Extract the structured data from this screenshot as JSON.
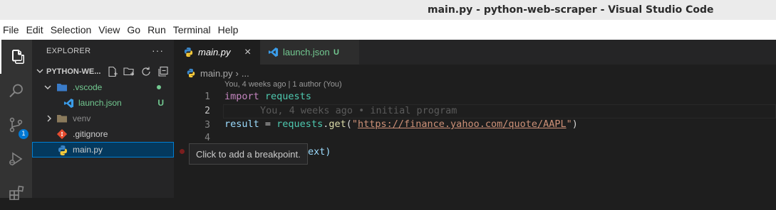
{
  "window": {
    "title": "main.py - python-web-scraper - Visual Studio Code"
  },
  "menu": [
    "File",
    "Edit",
    "Selection",
    "View",
    "Go",
    "Run",
    "Terminal",
    "Help"
  ],
  "activity_bar": {
    "items": [
      "files-icon",
      "search-icon",
      "source-control-icon",
      "run-debug-icon",
      "extensions-icon"
    ],
    "source_control_badge": "1"
  },
  "explorer": {
    "header": "EXPLORER",
    "more": "···",
    "folder": "PYTHON-WE...",
    "tree": [
      {
        "label": ".vscode",
        "type": "folder",
        "expanded": true,
        "color": "#73c991"
      },
      {
        "label": "launch.json",
        "type": "file",
        "status": "U",
        "color": "#73c991"
      },
      {
        "label": "venv",
        "type": "folder",
        "expanded": false,
        "color": "#8c8c8c"
      },
      {
        "label": ".gitignore",
        "type": "file",
        "color": "#cccccc"
      },
      {
        "label": "main.py",
        "type": "file",
        "selected": true,
        "color": "#cccccc"
      }
    ]
  },
  "tabs": [
    {
      "label": "main.py",
      "active": true,
      "close": "×"
    },
    {
      "label": "launch.json",
      "active": false,
      "status": "U"
    }
  ],
  "breadcrumb": {
    "file": "main.py",
    "sep": "›",
    "rest": "..."
  },
  "blame_header": "You, 4 weeks ago | 1 author (You)",
  "line_numbers": [
    "1",
    "2",
    "3",
    "4"
  ],
  "code": {
    "line1": {
      "kw": "import",
      "sp": " ",
      "mod": "requests"
    },
    "line2_ghost": "You, 4 weeks ago • initial program",
    "line3": {
      "var": "result",
      "op": " = ",
      "mod": "requests",
      "dot": ".",
      "fn": "get",
      "open": "(",
      "q1": "\"",
      "url": "https://finance.yahoo.com/quote/AAPL",
      "q2": "\"",
      "close": ")"
    },
    "line5_visible": "ext)"
  },
  "tooltip": "Click to add a breakpoint.",
  "colors": {
    "accent": "#007fd4",
    "untracked": "#73c991",
    "badge": "#0078d4"
  }
}
